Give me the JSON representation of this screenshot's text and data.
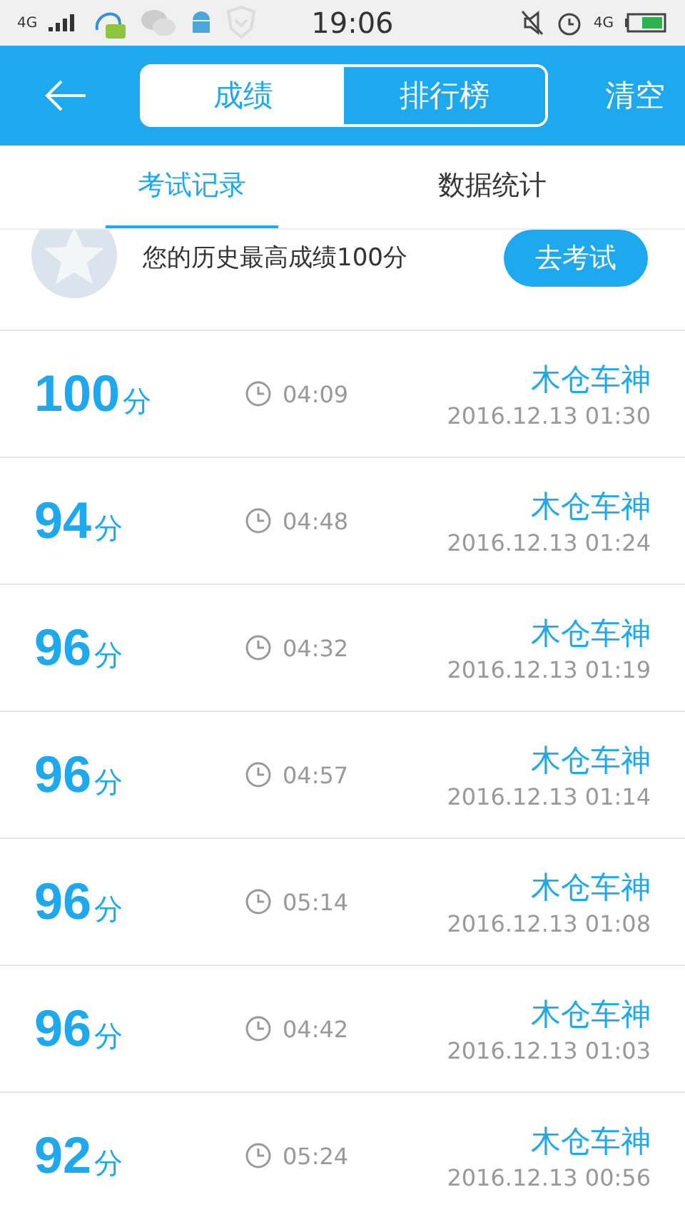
{
  "status_bar": {
    "network": "4G",
    "time": "19:06",
    "data": "4G"
  },
  "header": {
    "segments": [
      {
        "label": "成绩",
        "selected": true
      },
      {
        "label": "排行榜",
        "selected": false
      }
    ],
    "action": "清空"
  },
  "tabs": [
    {
      "label": "考试记录",
      "selected": true
    },
    {
      "label": "数据统计",
      "selected": false
    }
  ],
  "summary": {
    "text": "您的历史最高成绩100分",
    "button": "去考试"
  },
  "records": [
    {
      "score": "100",
      "unit": "分",
      "duration": "04:09",
      "name": "木仓车神",
      "date": "2016.12.13 01:30"
    },
    {
      "score": "94",
      "unit": "分",
      "duration": "04:48",
      "name": "木仓车神",
      "date": "2016.12.13 01:24"
    },
    {
      "score": "96",
      "unit": "分",
      "duration": "04:32",
      "name": "木仓车神",
      "date": "2016.12.13 01:19"
    },
    {
      "score": "96",
      "unit": "分",
      "duration": "04:57",
      "name": "木仓车神",
      "date": "2016.12.13 01:14"
    },
    {
      "score": "96",
      "unit": "分",
      "duration": "05:14",
      "name": "木仓车神",
      "date": "2016.12.13 01:08"
    },
    {
      "score": "96",
      "unit": "分",
      "duration": "04:42",
      "name": "木仓车神",
      "date": "2016.12.13 01:03"
    },
    {
      "score": "92",
      "unit": "分",
      "duration": "05:24",
      "name": "木仓车神",
      "date": "2016.12.13 00:56"
    }
  ]
}
